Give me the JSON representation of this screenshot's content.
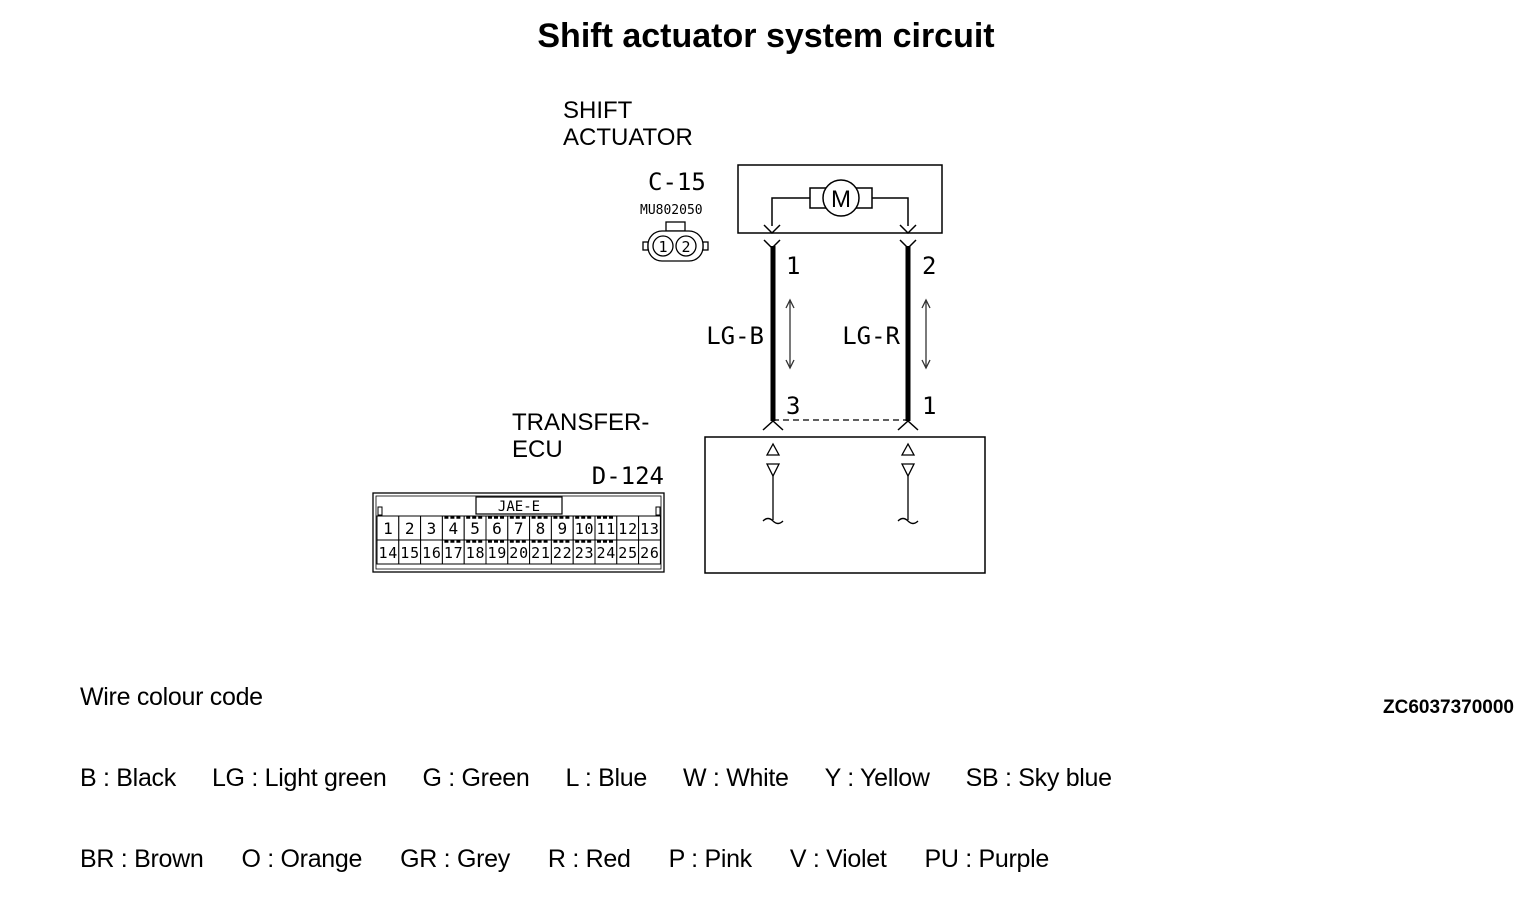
{
  "title": "Shift actuator system circuit",
  "actuator": {
    "name_line1": "SHIFT",
    "name_line2": "ACTUATOR",
    "connector_id": "C-15",
    "part_number": "MU802050",
    "connector_pins": [
      "1",
      "2"
    ],
    "motor_symbol": "M"
  },
  "wires": [
    {
      "color_code": "LG-B",
      "top_pin": "1",
      "bottom_pin": "3"
    },
    {
      "color_code": "LG-R",
      "top_pin": "2",
      "bottom_pin": "1"
    }
  ],
  "ecu": {
    "name_line1": "TRANSFER-",
    "name_line2": "ECU",
    "connector_id": "D-124",
    "connector_type": "JAE-E",
    "row1": [
      "1",
      "2",
      "3",
      "4",
      "5",
      "6",
      "7",
      "8",
      "9",
      "10",
      "11",
      "12",
      "13"
    ],
    "row2": [
      "14",
      "15",
      "16",
      "17",
      "18",
      "19",
      "20",
      "21",
      "22",
      "23",
      "24",
      "25",
      "26"
    ]
  },
  "legend": {
    "heading": "Wire colour code",
    "row1": [
      "B : Black",
      "LG : Light green",
      "G : Green",
      "L : Blue",
      "W : White",
      "Y : Yellow",
      "SB : Sky blue"
    ],
    "row2": [
      "BR : Brown",
      "O : Orange",
      "GR : Grey",
      "R : Red",
      "P : Pink",
      "V : Violet",
      "PU : Purple"
    ]
  },
  "figure_code": "ZC6037370000"
}
